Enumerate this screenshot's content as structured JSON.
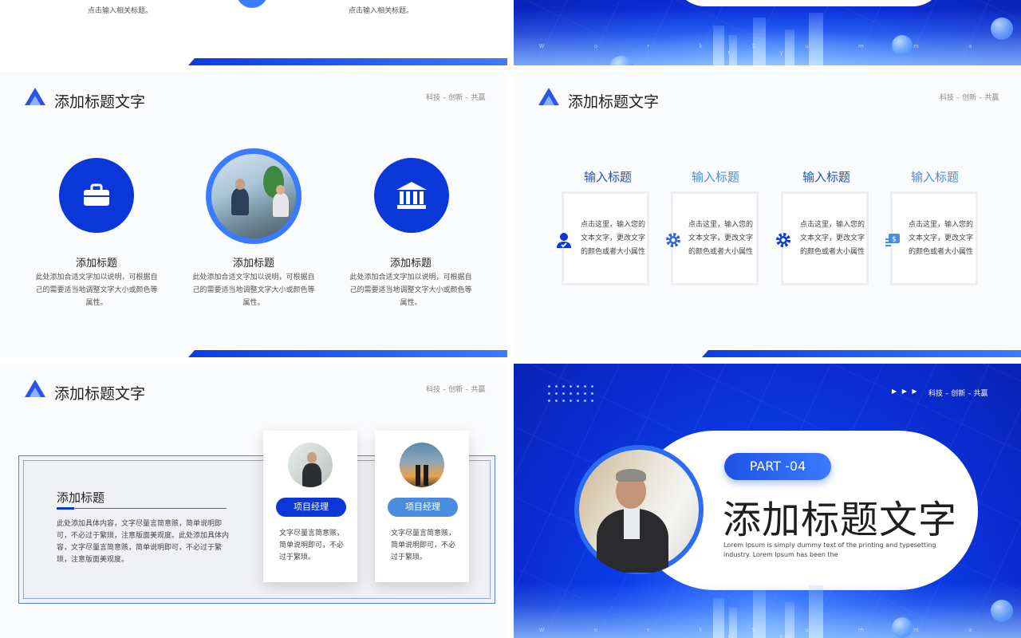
{
  "top_left_partial": {
    "caption_left": "点击输入相关标题。",
    "caption_right": "点击输入相关标题。"
  },
  "work_summary_watermark": "W o r k   S u m m a r y",
  "header": {
    "title": "添加标题文字",
    "tagline": "科技 – 创新 – 共赢"
  },
  "slide_three_columns": {
    "columns": [
      {
        "icon": "briefcase-icon",
        "title": "添加标题",
        "desc": "此处添加合适文字加以说明，可根据自己的需要适当地调整文字大小或颜色等属性。"
      },
      {
        "icon": "office-photo",
        "title": "添加标题",
        "desc": "此处添加合适文字加以说明，可根据自己的需要适当地调整文字大小或颜色等属性。"
      },
      {
        "icon": "bank-icon",
        "title": "添加标题",
        "desc": "此处添加合适文字加以说明，可根据自己的需要适当地调整文字大小或颜色等属性。"
      }
    ]
  },
  "slide_four_cards": {
    "cards": [
      {
        "title": "输入标题",
        "text": "点击这里，输入您的文本文字，更改文字的颜色或者大小属性",
        "icon": "user-check-icon"
      },
      {
        "title": "输入标题",
        "text": "点击这里，输入您的文本文字，更改文字的颜色或者大小属性",
        "icon": "gear-icon"
      },
      {
        "title": "输入标题",
        "text": "点击这里，输入您的文本文字，更改文字的颜色或者大小属性",
        "icon": "gear-icon"
      },
      {
        "title": "输入标题",
        "text": "点击这里，输入您的文本文字，更改文字的颜色或者大小属性",
        "icon": "money-icon"
      }
    ],
    "title_colors": [
      "#1f4fc2",
      "#4a8de0",
      "#1f4fc2",
      "#4a8de0"
    ]
  },
  "slide_team": {
    "box_title": "添加标题",
    "box_text": "此处添加具体内容，文字尽量言简意赅，简单说明即可，不必过于繁琐，注意版面美观度。此处添加具体内容，文字尽量言简意赅，简单说明即可，不必过于繁琐，注意版面美观度。",
    "members": [
      {
        "role": "项目经理",
        "text": "文字尽量言简意赅，简单说明即可，不必过于繁琐。",
        "pill_color": "#0b36d8"
      },
      {
        "role": "项目经理",
        "text": "文字尽量言简意赅，简单说明即可，不必过于繁琐。",
        "pill_color": "#4a8de0"
      }
    ]
  },
  "slide_part": {
    "arrows": "▶ ▶ ▶",
    "tagline": "科技 – 创新 – 共赢",
    "part_label": "PART -04",
    "title": "添加标题文字",
    "lorem": "Lorem Ipsum is simply dummy text of the printing and typesetting industry. Lorem Ipsum has been the"
  },
  "colors": {
    "primary": "#0b36d8",
    "accent": "#3a7bff",
    "light_blue": "#4a8de0"
  }
}
